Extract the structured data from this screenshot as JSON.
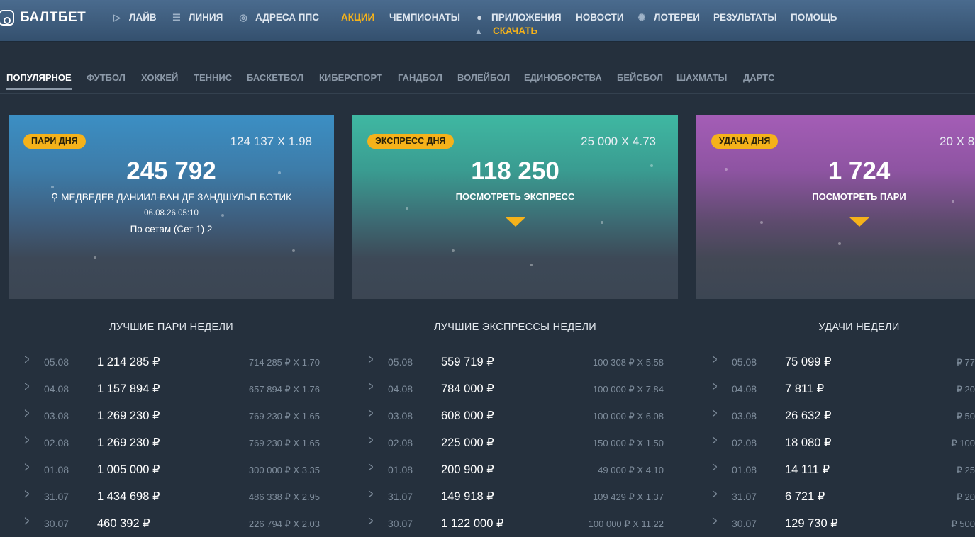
{
  "header": {
    "logo": "БАЛТБЕТ",
    "nav": [
      {
        "label": "ЛАЙВ",
        "icon": "play-circle-icon"
      },
      {
        "label": "ЛИНИЯ",
        "icon": "list-icon"
      },
      {
        "label": "АДРЕСА ППС",
        "icon": "location-pin-icon"
      },
      {
        "label": "АКЦИИ"
      },
      {
        "label": "ЧЕМПИОНАТЫ"
      },
      {
        "label": "ПРИЛОЖЕНИЯ",
        "icon": "apple-icon"
      },
      {
        "label": "НОВОСТИ"
      },
      {
        "label": "ЛОТЕРЕИ",
        "icon": "lottery-ball-icon"
      },
      {
        "label": "РЕЗУЛЬТАТЫ"
      },
      {
        "label": "ПОМОЩЬ"
      }
    ],
    "download": {
      "label": "СКАЧАТЬ",
      "icon": "android-icon"
    },
    "accent_color": "#f5b21a"
  },
  "tabs": [
    "ПОПУЛЯРНОЕ",
    "ФУТБОЛ",
    "ХОККЕЙ",
    "ТЕННИС",
    "БАСКЕТБОЛ",
    "КИБЕРСПОРТ",
    "ГАНДБОЛ",
    "ВОЛЕЙБОЛ",
    "ЕДИНОБОРСТВА",
    "БЕЙСБОЛ",
    "ШАХМАТЫ",
    "ДАРТС"
  ],
  "cards": [
    {
      "badge": "ПАРИ ДНЯ",
      "multiplier": "124 137 X 1.98",
      "amount": "245 792",
      "event": "МЕДВЕДЕВ ДАНИИЛ-ВАН ДЕ ЗАНДШУЛЬП БОТИК",
      "event_icon": "tennis-racket-icon",
      "datetime": "06.08.26 05:10",
      "bet": "По сетам (Сет 1) 2"
    },
    {
      "badge": "ЭКСПРЕСС ДНЯ",
      "multiplier": "25 000 X 4.73",
      "amount": "118 250",
      "link": "ПОСМОТРЕТЬ ЭКСПРЕСС"
    },
    {
      "badge": "УДАЧА ДНЯ",
      "multiplier": "20 X 8",
      "amount": "1 724",
      "link": "ПОСМОТРЕТЬ ПАРИ"
    }
  ],
  "sections": [
    {
      "title": "ЛУЧШИЕ ПАРИ НЕДЕЛИ",
      "rows": [
        {
          "date": "05.08",
          "amount": "1 214 285 ₽",
          "mult": "714 285 ₽ X 1.70"
        },
        {
          "date": "04.08",
          "amount": "1 157 894 ₽",
          "mult": "657 894 ₽ X 1.76"
        },
        {
          "date": "03.08",
          "amount": "1 269 230 ₽",
          "mult": "769 230 ₽ X 1.65"
        },
        {
          "date": "02.08",
          "amount": "1 269 230 ₽",
          "mult": "769 230 ₽ X 1.65"
        },
        {
          "date": "01.08",
          "amount": "1 005 000 ₽",
          "mult": "300 000 ₽ X 3.35"
        },
        {
          "date": "31.07",
          "amount": "1 434 698 ₽",
          "mult": "486 338 ₽ X 2.95"
        },
        {
          "date": "30.07",
          "amount": "460 392 ₽",
          "mult": "226 794 ₽ X 2.03"
        }
      ]
    },
    {
      "title": "ЛУЧШИЕ ЭКСПРЕССЫ НЕДЕЛИ",
      "rows": [
        {
          "date": "05.08",
          "amount": "559 719 ₽",
          "mult": "100 308 ₽ X 5.58"
        },
        {
          "date": "04.08",
          "amount": "784 000 ₽",
          "mult": "100 000 ₽ X 7.84"
        },
        {
          "date": "03.08",
          "amount": "608 000 ₽",
          "mult": "100 000 ₽ X 6.08"
        },
        {
          "date": "02.08",
          "amount": "225 000 ₽",
          "mult": "150 000 ₽ X 1.50"
        },
        {
          "date": "01.08",
          "amount": "200 900 ₽",
          "mult": "49 000 ₽ X 4.10"
        },
        {
          "date": "31.07",
          "amount": "149 918 ₽",
          "mult": "109 429 ₽ X 1.37"
        },
        {
          "date": "30.07",
          "amount": "1 122 000 ₽",
          "mult": "100 000 ₽ X 11.22"
        }
      ]
    },
    {
      "title": "УДАЧИ НЕДЕЛИ",
      "rows": [
        {
          "date": "05.08",
          "amount": "75 099 ₽",
          "mult": "77 ₽"
        },
        {
          "date": "04.08",
          "amount": "7 811 ₽",
          "mult": "20 ₽"
        },
        {
          "date": "03.08",
          "amount": "26 632 ₽",
          "mult": "50 ₽"
        },
        {
          "date": "02.08",
          "amount": "18 080 ₽",
          "mult": "100 ₽"
        },
        {
          "date": "01.08",
          "amount": "14 111 ₽",
          "mult": "25 ₽"
        },
        {
          "date": "31.07",
          "amount": "6 721 ₽",
          "mult": "20 ₽"
        },
        {
          "date": "30.07",
          "amount": "129 730 ₽",
          "mult": "500 ₽"
        }
      ]
    }
  ]
}
